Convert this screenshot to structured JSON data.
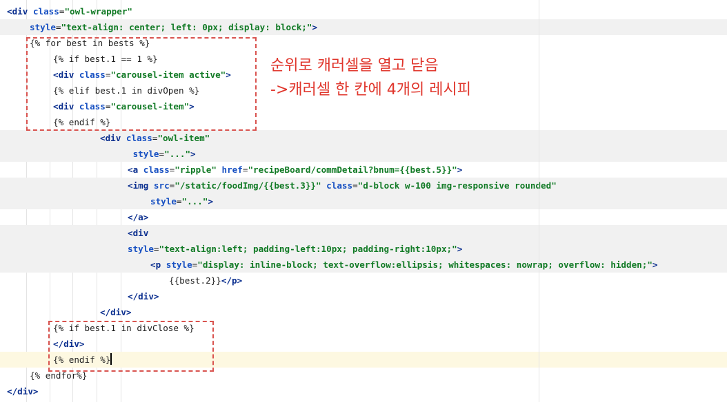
{
  "lines": [
    {
      "id": "l01",
      "indent": 0,
      "tokens": [
        [
          "tag",
          "<div "
        ],
        [
          "attr",
          "class"
        ],
        [
          "tpl",
          "="
        ],
        [
          "str",
          "\"owl-wrapper\""
        ]
      ]
    },
    {
      "id": "l02",
      "indent": 1,
      "tokens": [
        [
          "attr",
          "style"
        ],
        [
          "tpl",
          "="
        ],
        [
          "str",
          "\"text-align: center; left: 0px; display: block;\""
        ],
        [
          "tag",
          ">"
        ]
      ]
    },
    {
      "id": "l03",
      "indent": 1,
      "tokens": [
        [
          "tpl",
          "{% for best in bests %}"
        ]
      ]
    },
    {
      "id": "l04",
      "indent": 2,
      "tokens": [
        [
          "tpl",
          "{% if best.1 == 1 %}"
        ]
      ]
    },
    {
      "id": "l05",
      "indent": 2,
      "tokens": [
        [
          "tag",
          "<div "
        ],
        [
          "attr",
          "class"
        ],
        [
          "tpl",
          "="
        ],
        [
          "str",
          "\"carousel-item active\""
        ],
        [
          "tag",
          ">"
        ]
      ]
    },
    {
      "id": "l06",
      "indent": 2,
      "tokens": [
        [
          "tpl",
          "{% elif best.1 in divOpen %}"
        ]
      ]
    },
    {
      "id": "l07",
      "indent": 2,
      "tokens": [
        [
          "tag",
          "<div "
        ],
        [
          "attr",
          "class"
        ],
        [
          "tpl",
          "="
        ],
        [
          "str",
          "\"carousel-item\""
        ],
        [
          "tag",
          ">"
        ]
      ]
    },
    {
      "id": "l08",
      "indent": 2,
      "tokens": [
        [
          "tpl",
          "{% endif %}"
        ]
      ]
    },
    {
      "id": "l09",
      "indent": 4,
      "tokens": [
        [
          "tag",
          "<div "
        ],
        [
          "attr",
          "class"
        ],
        [
          "tpl",
          "="
        ],
        [
          "str",
          "\"owl-item\""
        ]
      ]
    },
    {
      "id": "l10",
      "indent": 5,
      "tokens": [
        [
          "tpl",
          " "
        ],
        [
          "attr",
          "style"
        ],
        [
          "tpl",
          "="
        ],
        [
          "str",
          "\"...\""
        ],
        [
          "tag",
          ">"
        ]
      ]
    },
    {
      "id": "l11",
      "indent": 5,
      "tokens": [
        [
          "tag",
          "<a "
        ],
        [
          "attr",
          "class"
        ],
        [
          "tpl",
          "="
        ],
        [
          "str",
          "\"ripple\" "
        ],
        [
          "attr",
          "href"
        ],
        [
          "tpl",
          "="
        ],
        [
          "str",
          "\"recipeBoard/commDetail?bnum={{best.5}}\""
        ],
        [
          "tag",
          ">"
        ]
      ]
    },
    {
      "id": "l12",
      "indent": 5,
      "tokens": [
        [
          "tag",
          "<img "
        ],
        [
          "attr",
          "src"
        ],
        [
          "tpl",
          "="
        ],
        [
          "str",
          "\"/static/foodImg/{{best.3}}\" "
        ],
        [
          "attr",
          "class"
        ],
        [
          "tpl",
          "="
        ],
        [
          "str",
          "\"d-block w-100 img-responsive rounded\""
        ]
      ]
    },
    {
      "id": "l13",
      "indent": 6,
      "tokens": [
        [
          "attr",
          "style"
        ],
        [
          "tpl",
          "="
        ],
        [
          "str",
          "\"...\""
        ],
        [
          "tag",
          ">"
        ]
      ]
    },
    {
      "id": "l14",
      "indent": 5,
      "tokens": [
        [
          "tag",
          "</a>"
        ]
      ]
    },
    {
      "id": "l15",
      "indent": 5,
      "tokens": [
        [
          "tag",
          "<div"
        ]
      ]
    },
    {
      "id": "l16",
      "indent": 5,
      "tokens": [
        [
          "attr",
          "style"
        ],
        [
          "tpl",
          "="
        ],
        [
          "str",
          "\"text-align:left; padding-left:10px; padding-right:10px;\""
        ],
        [
          "tag",
          ">"
        ]
      ]
    },
    {
      "id": "l17",
      "indent": 6,
      "tokens": [
        [
          "tag",
          "<p "
        ],
        [
          "attr",
          "style"
        ],
        [
          "tpl",
          "="
        ],
        [
          "str",
          "\"display: inline-block; text-overflow:ellipsis; whitespaces: nowrap; overflow: hidden;\""
        ],
        [
          "tag",
          ">"
        ]
      ]
    },
    {
      "id": "l18",
      "indent": 7,
      "tokens": [
        [
          "tpl",
          "{{best.2}}"
        ],
        [
          "tag",
          "</p>"
        ]
      ]
    },
    {
      "id": "l19",
      "indent": 5,
      "tokens": [
        [
          "tag",
          "</div>"
        ]
      ]
    },
    {
      "id": "l20",
      "indent": 4,
      "tokens": [
        [
          "tag",
          "</div>"
        ]
      ]
    },
    {
      "id": "l21",
      "indent": 2,
      "tokens": [
        [
          "tpl",
          "{% if best.1 in divClose %}"
        ]
      ]
    },
    {
      "id": "l22",
      "indent": 2,
      "tokens": [
        [
          "tag",
          "</div>"
        ]
      ]
    },
    {
      "id": "l23",
      "indent": 2,
      "tokens": [
        [
          "tpl",
          "{% endif %}"
        ]
      ]
    },
    {
      "id": "l24",
      "indent": 1,
      "tokens": [
        [
          "tpl",
          "{% endfor%}"
        ]
      ]
    },
    {
      "id": "l25",
      "indent": 0,
      "tokens": [
        [
          "tag",
          "</div>"
        ]
      ]
    }
  ],
  "annotation": {
    "line1": "순위로 캐러셀을 열고 닫음",
    "line2": "->캐러셀 한 칸에 4개의 레시피"
  },
  "colors": {
    "annotation": "#e0362c",
    "tag": "#0b2f8f",
    "attribute": "#1750c2",
    "string": "#117a25"
  }
}
